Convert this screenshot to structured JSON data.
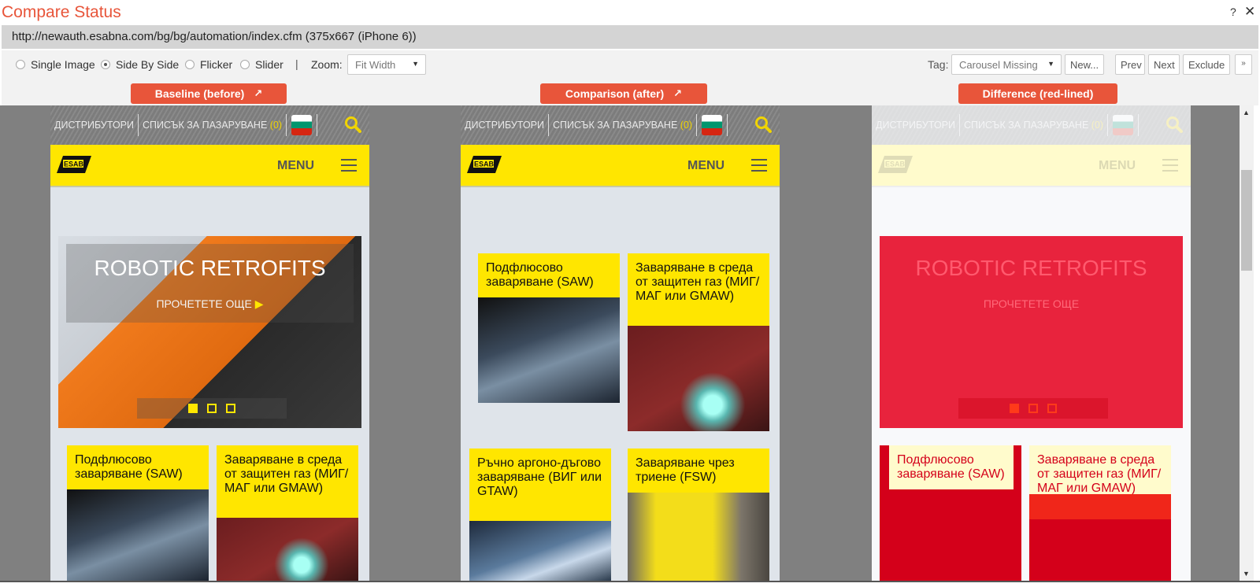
{
  "window": {
    "title": "Compare Status",
    "help_label": "?",
    "close_label": "✕"
  },
  "url_bar": {
    "text": "http://newauth.esabna.com/bg/bg/automation/index.cfm (375x667 (iPhone 6))"
  },
  "toolbar": {
    "view_modes": [
      {
        "label": "Single Image",
        "selected": false
      },
      {
        "label": "Side By Side",
        "selected": true
      },
      {
        "label": "Flicker",
        "selected": false
      },
      {
        "label": "Slider",
        "selected": false
      }
    ],
    "separator": "|",
    "zoom_label": "Zoom:",
    "zoom_value": "Fit Width",
    "tag_label": "Tag:",
    "tag_value": "Carousel Missing",
    "new_label": "New...",
    "prev_label": "Prev",
    "next_label": "Next",
    "exclude_label": "Exclude",
    "expand_icon": "double-chevron-down"
  },
  "panels": {
    "baseline_label": "Baseline (before)",
    "comparison_label": "Comparison (after)",
    "difference_label": "Difference (red-lined)",
    "external_icon": "↗"
  },
  "site": {
    "nav": {
      "distributors": "ДИСТРИБУТОРИ",
      "shopping_list": "СПИСЪК ЗА ПАЗАРУВАНЕ",
      "count": "(0)"
    },
    "logo": "ESAB",
    "menu_label": "MENU",
    "carousel": {
      "heading": "ROBOTIC RETROFITS",
      "more": "ПРОЧЕТЕТЕ ОЩЕ",
      "slides": 3,
      "active_slide": 1
    },
    "cards": [
      {
        "title": "Подфлюсово заваряване (SAW)"
      },
      {
        "title": "Заваряване в среда от защитен газ (МИГ/МАГ или GMAW)"
      },
      {
        "title": "Ръчно аргоно-дъгово заваряване (ВИГ или GTAW)"
      },
      {
        "title": "Заваряване чрез триене (FSW)"
      }
    ]
  },
  "colors": {
    "accent": "#e8553a",
    "site_yellow": "#ffe600",
    "diff_red": "#e8233d"
  }
}
